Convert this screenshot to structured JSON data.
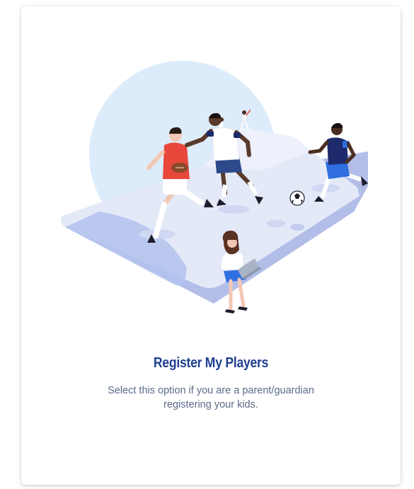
{
  "card": {
    "title": "Register My Players",
    "description": "Select this option if you are a parent/guardian registering your kids."
  },
  "colors": {
    "title": "#1f3f8f",
    "description": "#5b6b8a",
    "circle": "#dcecfb",
    "field": "#e2e7f7",
    "field_edge": "#aab6e6",
    "accent_blue": "#2f6fe0",
    "jersey_red": "#e8473b",
    "jersey_navy": "#1d2a6b"
  },
  "icons": {
    "illustration": "youth-sports-registration-illustration"
  }
}
